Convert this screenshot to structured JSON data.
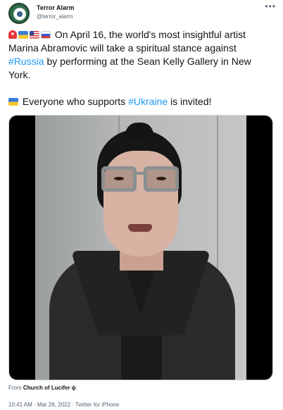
{
  "author": {
    "name": "Terror Alarm",
    "handle": "@terror_alarm",
    "avatar_icon": "terror-alarm-logo-icon"
  },
  "menu_icon": "•••",
  "tweet": {
    "emojis": [
      "siren-icon",
      "ukraine-flag-icon",
      "us-flag-icon",
      "russia-flag-icon"
    ],
    "para1_before": " On April 16, the world's most insightful artist Marina Abramovic will take a spiritual stance against ",
    "hashtag1": "#Russia",
    "para1_after": " by performing at the Sean Kelly Gallery in New York.",
    "para2_emoji": "ukraine-flag-icon",
    "para2_before": " Everyone who supports ",
    "hashtag2": "#Ukraine",
    "para2_after": " is invited!"
  },
  "media": {
    "type": "video"
  },
  "source": {
    "prefix": "From ",
    "name": "Church of Lucifer ψ"
  },
  "meta": {
    "time": "10:41 AM",
    "separator1": " · ",
    "date": "Mar 26, 2022",
    "separator2": " · ",
    "client": "Twitter for iPhone"
  },
  "colors": {
    "link": "#1d9bf0",
    "text": "#0f1419",
    "muted": "#536471"
  }
}
